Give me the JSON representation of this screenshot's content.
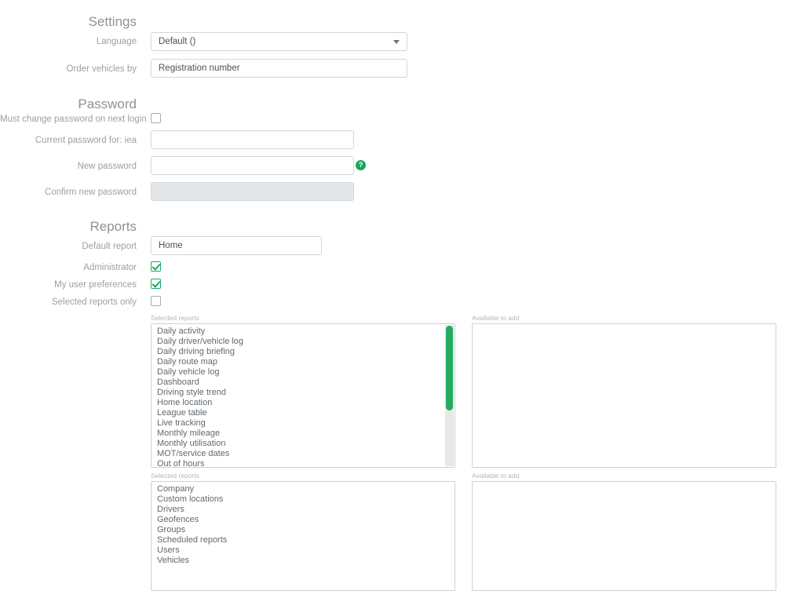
{
  "sections": {
    "settings": {
      "title": "Settings",
      "language": {
        "label": "Language",
        "value": "Default ()",
        "caret_icon": "chevron-down-icon"
      },
      "order_vehicles_by": {
        "label": "Order vehicles by",
        "value": "Registration number",
        "placeholder": ""
      }
    },
    "password": {
      "title": "Password",
      "must_change": {
        "label": "Must change password on next login",
        "checked": false
      },
      "current_password": {
        "label": "Current password for: iea",
        "value": "",
        "placeholder": ""
      },
      "new_password": {
        "label": "New password",
        "value": "",
        "placeholder": "",
        "help_icon": "help-circle-icon",
        "help_glyph": "?"
      },
      "confirm_password": {
        "label": "Confirm new password",
        "value": "",
        "placeholder": "",
        "disabled": true
      }
    },
    "reports": {
      "title": "Reports",
      "default_report": {
        "label": "Default report",
        "value": "Home",
        "placeholder": ""
      },
      "administrator": {
        "label": "Administrator",
        "checked": true
      },
      "my_user_preferences": {
        "label": "My user preferences",
        "checked": true
      },
      "selected_reports_only": {
        "label": "Selected reports only",
        "checked": false
      },
      "reports_picker": {
        "selected_label": "Selected reports",
        "available_label": "Available to add",
        "selected_items": [
          "Daily activity",
          "Daily driver/vehicle log",
          "Daily driving briefing",
          "Daily route map",
          "Daily vehicle log",
          "Dashboard",
          "Driving style trend",
          "Home location",
          "League table",
          "Live tracking",
          "Monthly mileage",
          "Monthly utilisation",
          "MOT/service dates",
          "Out of hours"
        ],
        "available_items": []
      },
      "admin_picker": {
        "selected_label": "Selected reports",
        "available_label": "Available to add",
        "selected_items": [
          "Company",
          "Custom locations",
          "Drivers",
          "Geofences",
          "Groups",
          "Scheduled reports",
          "Users",
          "Vehicles"
        ],
        "available_items": []
      }
    }
  },
  "colors": {
    "accent_green": "#16a75c",
    "scrollbar_green": "#25ab60",
    "label_grey": "#9aa0a6",
    "border_grey": "#d3d7db",
    "disabled_bg": "#e3e7ea"
  }
}
